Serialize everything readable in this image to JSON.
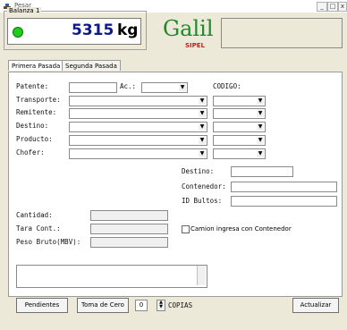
{
  "window": {
    "title": "Pesar",
    "minimize": "_",
    "maximize": "□",
    "close": "x"
  },
  "scale": {
    "group_label": "Balanza 1",
    "weight": "5315",
    "unit": "kg"
  },
  "brand": {
    "name": "Galil",
    "sub": "SIPEL"
  },
  "tabs": [
    {
      "label": "Primera Pasada"
    },
    {
      "label": "Segunda Pasada"
    }
  ],
  "form": {
    "patente_label": "Patente:",
    "ac_label": "Ac.:",
    "codigo_label": "CODIGO:",
    "transporte_label": "Transporte:",
    "remitente_label": "Remitente:",
    "destino_label": "Destino:",
    "producto_label": "Producto:",
    "chofer_label": "Chofer:",
    "destino2_label": "Destino:",
    "contenedor_label": "Contenedor:",
    "id_bultos_label": "ID Bultos:",
    "cantidad_label": "Cantidad:",
    "tara_label": "Tara Cont.:",
    "peso_bruto_label": "Peso Bruto(MBV):",
    "contenedor_check_label": "Camion ingresa con Contenedor"
  },
  "buttons": {
    "pendientes": "Pendientes",
    "toma_cero": "Toma de Cero",
    "copias_value": "0",
    "copias_label": "COPIAS",
    "actualizar": "Actualizar"
  },
  "colors": {
    "weight": "#0b1a8a",
    "led": "#1ad01a",
    "brand": "#1c8a2b",
    "brand_sub": "#c81e1e"
  }
}
